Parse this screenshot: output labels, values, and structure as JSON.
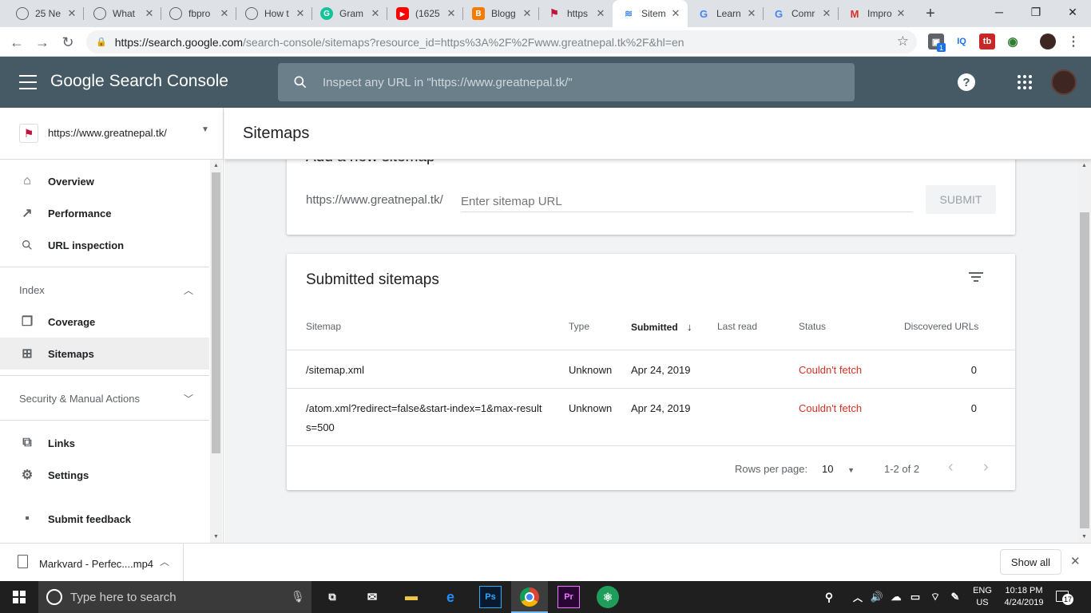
{
  "tabs": [
    {
      "title": "25 Ne",
      "icon": "globe-icon"
    },
    {
      "title": "What",
      "icon": "globe-icon"
    },
    {
      "title": "fbpro",
      "icon": "globe-icon"
    },
    {
      "title": "How t",
      "icon": "globe-icon"
    },
    {
      "title": "Gram",
      "icon": "grammarly-icon"
    },
    {
      "title": "(1625",
      "icon": "youtube-icon"
    },
    {
      "title": "Blogg",
      "icon": "blogger-icon"
    },
    {
      "title": "https",
      "icon": "nepal-flag-icon"
    },
    {
      "title": "Sitem",
      "icon": "search-console-icon"
    },
    {
      "title": "Learn",
      "icon": "google-icon"
    },
    {
      "title": "Comr",
      "icon": "google-icon"
    },
    {
      "title": "Impro",
      "icon": "gmail-icon"
    }
  ],
  "browser": {
    "url_host": "https://search.google.com",
    "url_path": "/search-console/sitemaps?resource_id=https%3A%2F%2Fwww.greatnepal.tk%2F&hl=en",
    "ext_badge": "1",
    "ext_iq": "IQ",
    "ext_tb": "tb"
  },
  "header": {
    "product_google": "Google",
    "product_name": "Search Console",
    "search_placeholder": "Inspect any URL in \"https://www.greatnepal.tk/\""
  },
  "sidebar": {
    "property": "https://www.greatnepal.tk/",
    "items": {
      "overview": "Overview",
      "performance": "Performance",
      "url_inspection": "URL inspection",
      "index_header": "Index",
      "coverage": "Coverage",
      "sitemaps": "Sitemaps",
      "security_header": "Security & Manual Actions",
      "links": "Links",
      "settings": "Settings",
      "feedback": "Submit feedback"
    }
  },
  "page": {
    "title": "Sitemaps",
    "add_card_title": "Add a new sitemap",
    "url_prefix": "https://www.greatnepal.tk/",
    "sitemap_placeholder": "Enter sitemap URL",
    "submit_label": "SUBMIT"
  },
  "submitted": {
    "title": "Submitted sitemaps",
    "columns": {
      "sitemap": "Sitemap",
      "type": "Type",
      "submitted": "Submitted",
      "last_read": "Last read",
      "status": "Status",
      "discovered": "Discovered URLs"
    },
    "rows": [
      {
        "sitemap": "/sitemap.xml",
        "sitemap_line2": "",
        "type": "Unknown",
        "submitted": "Apr 24, 2019",
        "last_read": "",
        "status": "Couldn't fetch",
        "discovered": "0"
      },
      {
        "sitemap": "/atom.xml?redirect=false&start-index=1&max-result",
        "sitemap_line2": "s=500",
        "type": "Unknown",
        "submitted": "Apr 24, 2019",
        "last_read": "",
        "status": "Couldn't fetch",
        "discovered": "0"
      }
    ],
    "rows_per_page_label": "Rows per page:",
    "rows_per_page_value": "10",
    "range": "1-2 of 2",
    "status_error_color": "#d93025"
  },
  "download": {
    "filename": "Markvard - Perfec....mp4",
    "show_all": "Show all"
  },
  "taskbar": {
    "search_placeholder": "Type here to search",
    "lang_line1": "ENG",
    "lang_line2": "US",
    "time": "10:18 PM",
    "date": "4/24/2019",
    "notification_count": "17"
  },
  "colors": {
    "header_bg": "#455a64",
    "accent_red": "#d93025",
    "taskbar_bg": "#1f1f1f"
  }
}
